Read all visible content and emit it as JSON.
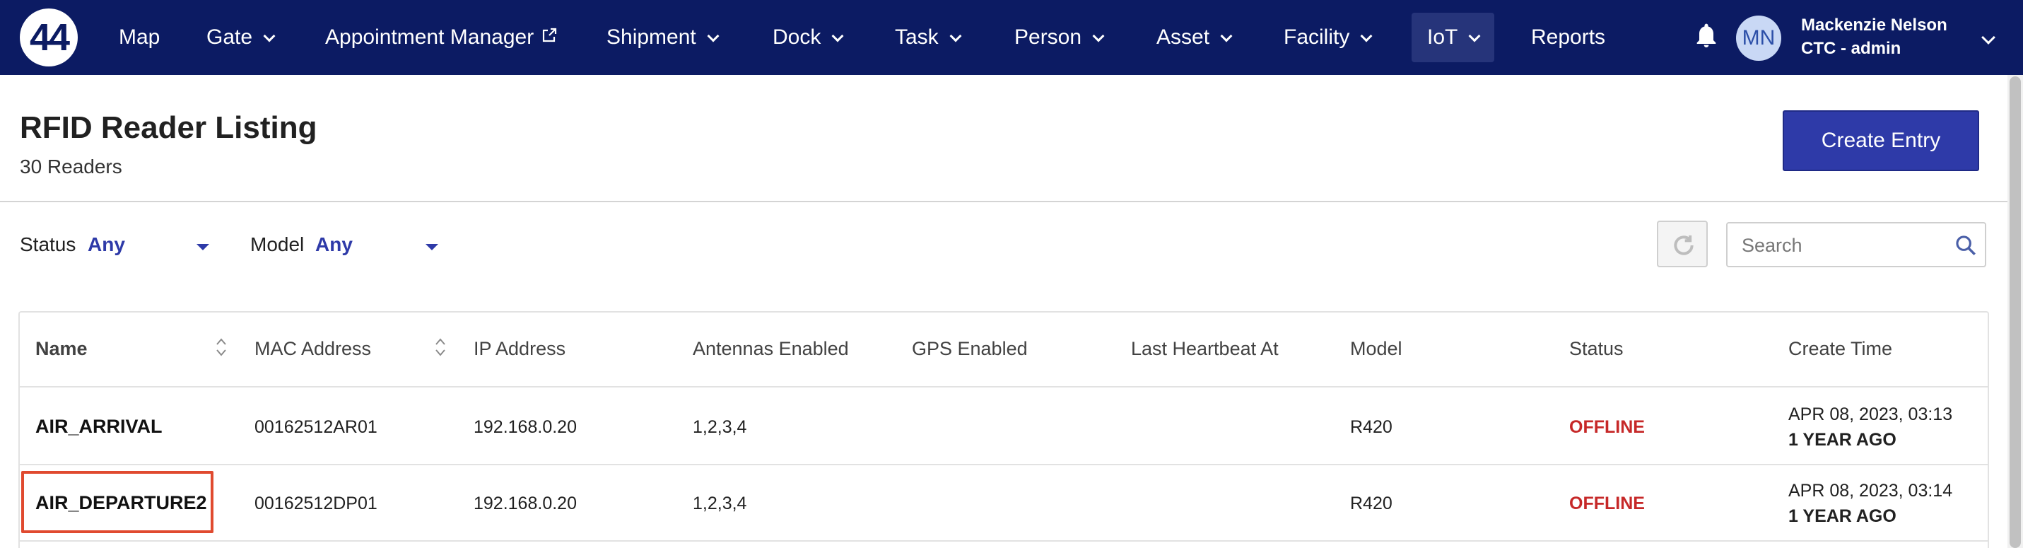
{
  "nav": {
    "logo": "44",
    "items": [
      {
        "label": "Map"
      },
      {
        "label": "Gate"
      },
      {
        "label": "Appointment Manager"
      },
      {
        "label": "Shipment"
      },
      {
        "label": "Dock"
      },
      {
        "label": "Task"
      },
      {
        "label": "Person"
      },
      {
        "label": "Asset"
      },
      {
        "label": "Facility"
      },
      {
        "label": "IoT"
      },
      {
        "label": "Reports"
      }
    ],
    "user": {
      "initials": "MN",
      "name": "Mackenzie Nelson",
      "role": "CTC - admin"
    }
  },
  "header": {
    "title": "RFID Reader Listing",
    "subtitle": "30 Readers",
    "create_label": "Create Entry"
  },
  "filters": {
    "status_label": "Status",
    "status_value": "Any",
    "model_label": "Model",
    "model_value": "Any",
    "search_placeholder": "Search"
  },
  "table": {
    "columns": [
      "Name",
      "MAC Address",
      "IP Address",
      "Antennas Enabled",
      "GPS Enabled",
      "Last Heartbeat At",
      "Model",
      "Status",
      "Create Time"
    ],
    "rows": [
      {
        "name": "AIR_ARRIVAL",
        "mac": "00162512AR01",
        "ip": "192.168.0.20",
        "antennas": "1,2,3,4",
        "gps": "",
        "heartbeat": "",
        "model": "R420",
        "status": "OFFLINE",
        "create_date": "APR 08, 2023, 03:13",
        "create_ago": "1 YEAR AGO"
      },
      {
        "name": "AIR_DEPARTURE2",
        "mac": "00162512DP01",
        "ip": "192.168.0.20",
        "antennas": "1,2,3,4",
        "gps": "",
        "heartbeat": "",
        "model": "R420",
        "status": "OFFLINE",
        "create_date": "APR 08, 2023, 03:14",
        "create_ago": "1 YEAR AGO"
      }
    ]
  },
  "colors": {
    "nav_bg": "#0c1b63",
    "primary": "#2e3aa8",
    "status_offline": "#c62828",
    "highlight": "#e04a2f"
  }
}
